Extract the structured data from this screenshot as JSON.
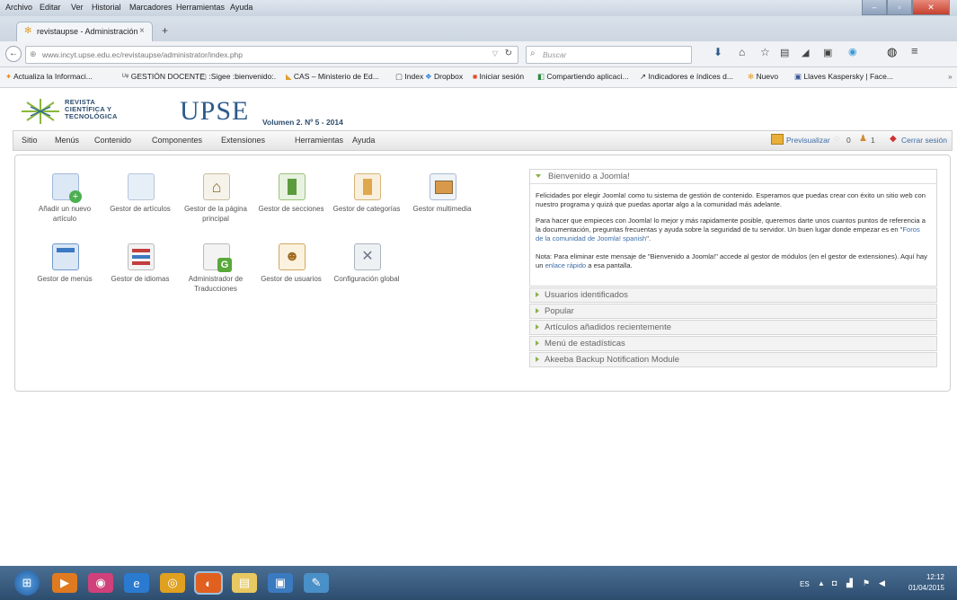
{
  "browser": {
    "menu": [
      "Archivo",
      "Editar",
      "Ver",
      "Historial",
      "Marcadores",
      "Herramientas",
      "Ayuda"
    ],
    "tab_title": "revistaupse - Administración",
    "tab_close": "×",
    "new_tab": "+",
    "url": "www.incyt.upse.edu.ec/revistaupse/administrator/index.php",
    "search_placeholder": "Buscar",
    "bookmarks": [
      "Actualiza la Informaci...",
      "GESTIÓN DOCENTE",
      ":Sigee :bienvenido:.",
      "CAS – Ministerio de Ed...",
      "Index",
      "Dropbox",
      "Iniciar sesión",
      "Compartiendo aplicaci...",
      "Indicadores e índices d...",
      "Nuevo",
      "Llaves Kaspersky | Face..."
    ]
  },
  "header": {
    "logo_text_1": "REVISTA",
    "logo_text_2": "CIENTÍFICA Y",
    "logo_text_3": "TECNOLÓGICA",
    "brand": "UPSE",
    "volume": "Volumen 2. Nº 5 - 2014"
  },
  "menu": [
    "Sitio",
    "Menús",
    "Contenido",
    "Componentes",
    "Extensiones",
    "Herramientas",
    "Ayuda"
  ],
  "status": {
    "preview": "Previsualizar",
    "count_a": "0",
    "count_b": "1",
    "logout": "Cerrar sesión"
  },
  "icons": [
    {
      "label": "Añadir un nuevo artículo",
      "name": "add-article-icon",
      "color": "#6aa0d8"
    },
    {
      "label": "Gestor de artículos",
      "name": "article-manager-icon",
      "color": "#c7d6e8"
    },
    {
      "label": "Gestor de la página principal",
      "name": "frontpage-manager-icon",
      "color": "#d8d0b8"
    },
    {
      "label": "Gestor de secciones",
      "name": "section-manager-icon",
      "color": "#5c9a3e"
    },
    {
      "label": "Gestor de categorías",
      "name": "category-manager-icon",
      "color": "#e0a84c"
    },
    {
      "label": "Gestor multimedia",
      "name": "media-manager-icon",
      "color": "#9fb8d8"
    },
    {
      "label": "Gestor de menús",
      "name": "menu-manager-icon",
      "color": "#3d78c2"
    },
    {
      "label": "Gestor de idiomas",
      "name": "language-manager-icon",
      "color": "#c23d3d"
    },
    {
      "label": "Administrador de Traducciones",
      "name": "translation-manager-icon",
      "color": "#58a83a"
    },
    {
      "label": "Gestor de usuarios",
      "name": "user-manager-icon",
      "color": "#d69a3a"
    },
    {
      "label": "Configuración global",
      "name": "global-config-icon",
      "color": "#d0d8e0"
    }
  ],
  "welcome": {
    "title": "Bienvenido a Joomla!",
    "p1": "Felicidades por elegir Joomla! como tu sistema de gestión de contenido. Esperamos que puedas crear con éxito un sitio web con nuestro programa y quizá que puedas aportar algo a la comunidad más adelante.",
    "p2a": "Para hacer que empieces con Joomla! lo mejor y más rapidamente posible, queremos darte unos cuantos puntos de referencia a la documentación, preguntas frecuentas y ayuda sobre la seguridad de tu servidor. Un buen lugar donde empezar es en \"",
    "p2link": "Foros de la comunidad de Joomla! spanish",
    "p2b": "\".",
    "p3a": "Nota: Para eliminar este mensaje de \"Bienvenido a Joomla!\" accede al gestor de módulos (en el gestor de extensiones). Aquí hay un ",
    "p3link": "enlace rápido",
    "p3b": " a esa pantalla."
  },
  "modules": [
    "Usuarios identificados",
    "Popular",
    "Artículos añadidos recientemente",
    "Menú de estadísticas",
    "Akeeba Backup Notification Module"
  ],
  "taskbar": {
    "lang": "ES",
    "time": "12:12",
    "date": "01/04/2015"
  }
}
